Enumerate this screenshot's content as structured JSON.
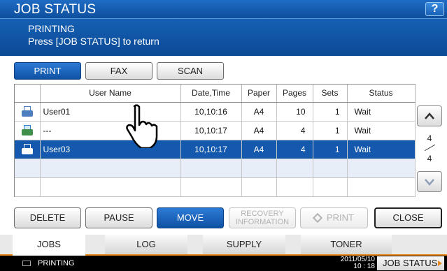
{
  "header": {
    "title": "JOB STATUS",
    "help_label": "?"
  },
  "message": {
    "line1": "PRINTING",
    "line2": "Press [JOB STATUS] to return"
  },
  "type_tabs": [
    "PRINT",
    "FAX",
    "SCAN"
  ],
  "table": {
    "columns": [
      "User Name",
      "Date,Time",
      "Paper",
      "Pages",
      "Sets",
      "Status"
    ],
    "rows": [
      {
        "user": "User01",
        "datetime": "10,10:16",
        "paper": "A4",
        "pages": "10",
        "sets": "1",
        "status": "Wait"
      },
      {
        "user": "---",
        "datetime": "10,10:17",
        "paper": "A4",
        "pages": "4",
        "sets": "1",
        "status": "Wait"
      },
      {
        "user": "User03",
        "datetime": "10,10:17",
        "paper": "A4",
        "pages": "4",
        "sets": "1",
        "status": "Wait"
      }
    ]
  },
  "pagination": {
    "current": "4",
    "total": "4"
  },
  "actions": {
    "delete": "DELETE",
    "pause": "PAUSE",
    "move": "MOVE",
    "recovery_line1": "RECOVERY",
    "recovery_line2": "INFORMATION",
    "print": "PRINT",
    "close": "CLOSE"
  },
  "bottom_tabs": [
    "JOBS",
    "LOG",
    "SUPPLY",
    "TONER"
  ],
  "statusbar": {
    "status_text": "PRINTING",
    "date": "2011/05/10",
    "time": "10 : 18",
    "job_status_label": "JOB STATUS"
  },
  "colors": {
    "accent_blue": "#1459ad",
    "tab_underline": "#e8891c"
  }
}
